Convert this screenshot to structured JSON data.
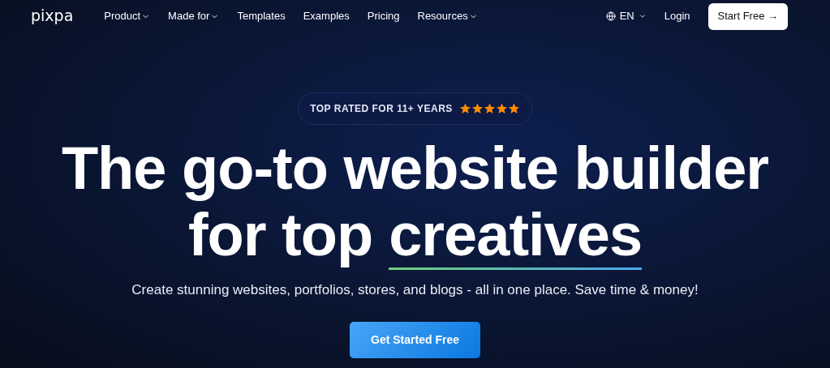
{
  "nav": {
    "logo": "pixpa",
    "items": [
      {
        "label": "Product",
        "dropdown": true
      },
      {
        "label": "Made for",
        "dropdown": true
      },
      {
        "label": "Templates",
        "dropdown": false
      },
      {
        "label": "Examples",
        "dropdown": false
      },
      {
        "label": "Pricing",
        "dropdown": false
      },
      {
        "label": "Resources",
        "dropdown": true
      }
    ],
    "language": "EN",
    "login": "Login",
    "cta": "Start Free →"
  },
  "hero": {
    "badge": {
      "text": "TOP RATED FOR 11+ YEARS",
      "stars": 5
    },
    "headline_line1": "The go-to website builder",
    "headline_line2": "for top",
    "headline_highlight": "creatives",
    "subtitle": "Create stunning websites, portfolios, stores, and blogs - all in one place. Save time & money!",
    "button": "Get Started Free"
  }
}
